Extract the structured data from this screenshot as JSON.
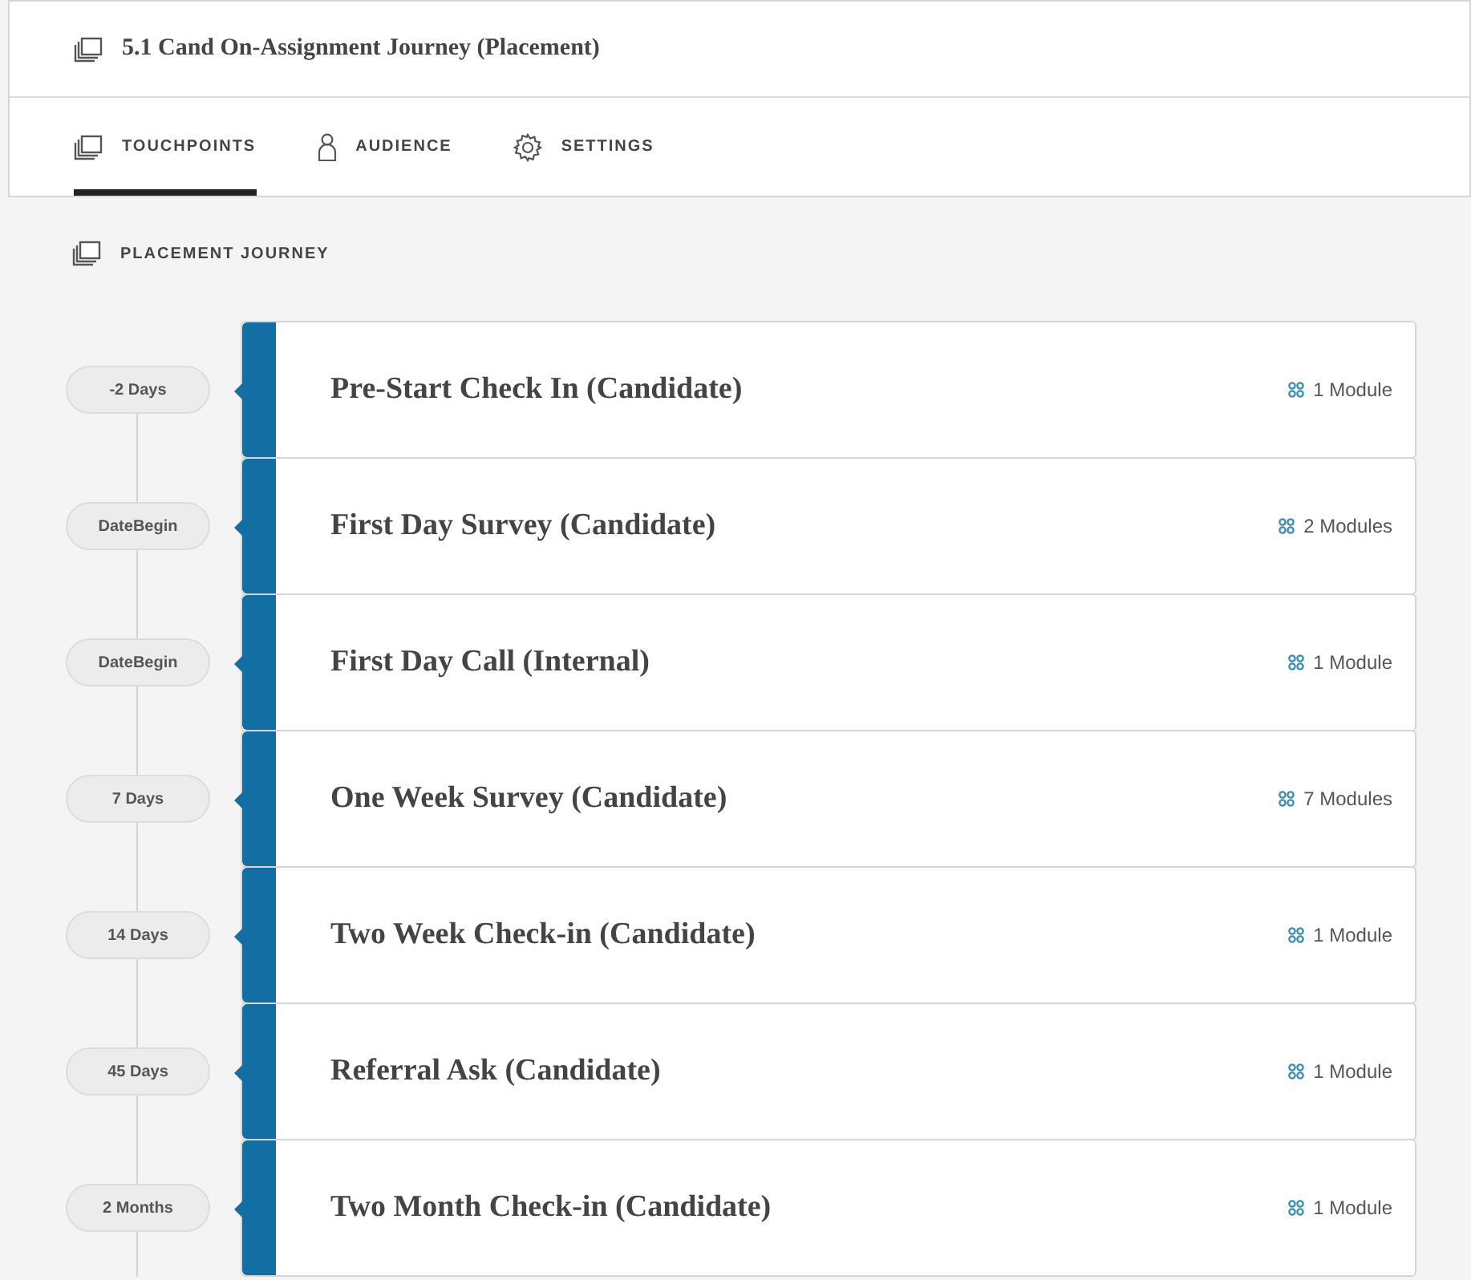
{
  "header": {
    "title": "5.1 Cand On-Assignment Journey (Placement)"
  },
  "tabs": [
    {
      "label": "TOUCHPOINTS",
      "kind": "stack",
      "selected": true
    },
    {
      "label": "AUDIENCE",
      "kind": "person",
      "selected": false
    },
    {
      "label": "SETTINGS",
      "kind": "gear",
      "selected": false
    }
  ],
  "section": {
    "title": "PLACEMENT JOURNEY"
  },
  "touchpoints": [
    {
      "timing": "-2 Days",
      "title": "Pre-Start Check In (Candidate)",
      "modules": "1 Module"
    },
    {
      "timing": "DateBegin",
      "title": "First Day Survey (Candidate)",
      "modules": "2 Modules"
    },
    {
      "timing": "DateBegin",
      "title": "First Day Call (Internal)",
      "modules": "1 Module"
    },
    {
      "timing": "7 Days",
      "title": "One Week Survey (Candidate)",
      "modules": "7 Modules"
    },
    {
      "timing": "14 Days",
      "title": "Two Week Check-in (Candidate)",
      "modules": "1 Module"
    },
    {
      "timing": "45 Days",
      "title": "Referral Ask (Candidate)",
      "modules": "1 Module"
    },
    {
      "timing": "2 Months",
      "title": "Two Month Check-in (Candidate)",
      "modules": "1 Module"
    }
  ]
}
